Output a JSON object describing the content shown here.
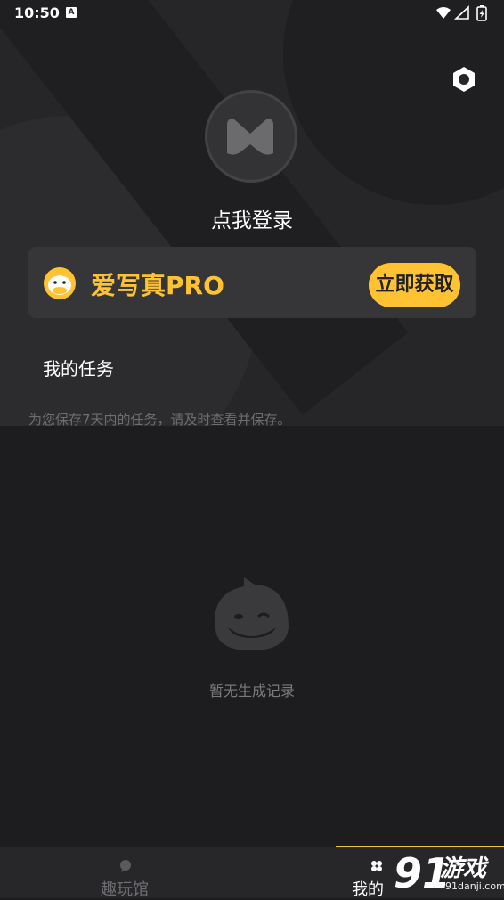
{
  "status_bar": {
    "time": "10:50",
    "notification_letter": "A"
  },
  "profile": {
    "login_text": "点我登录"
  },
  "pro_banner": {
    "title": "爱写真PRO",
    "button_label": "立即获取",
    "accent_color": "#ffc233"
  },
  "tasks": {
    "title": "我的任务",
    "note": "为您保存7天内的任务，请及时查看并保存。",
    "empty_text": "暂无生成记录"
  },
  "tab_bar": {
    "tabs": [
      {
        "label": "趣玩馆",
        "icon": "chat-bubble-icon",
        "active": false
      },
      {
        "label": "我的",
        "icon": "clover-icon",
        "active": true
      }
    ]
  },
  "watermark": {
    "main": "游戏",
    "sub": "91danji.com"
  },
  "colors": {
    "background": "#1d1d1f",
    "card": "#363639",
    "accent": "#ffc233"
  }
}
